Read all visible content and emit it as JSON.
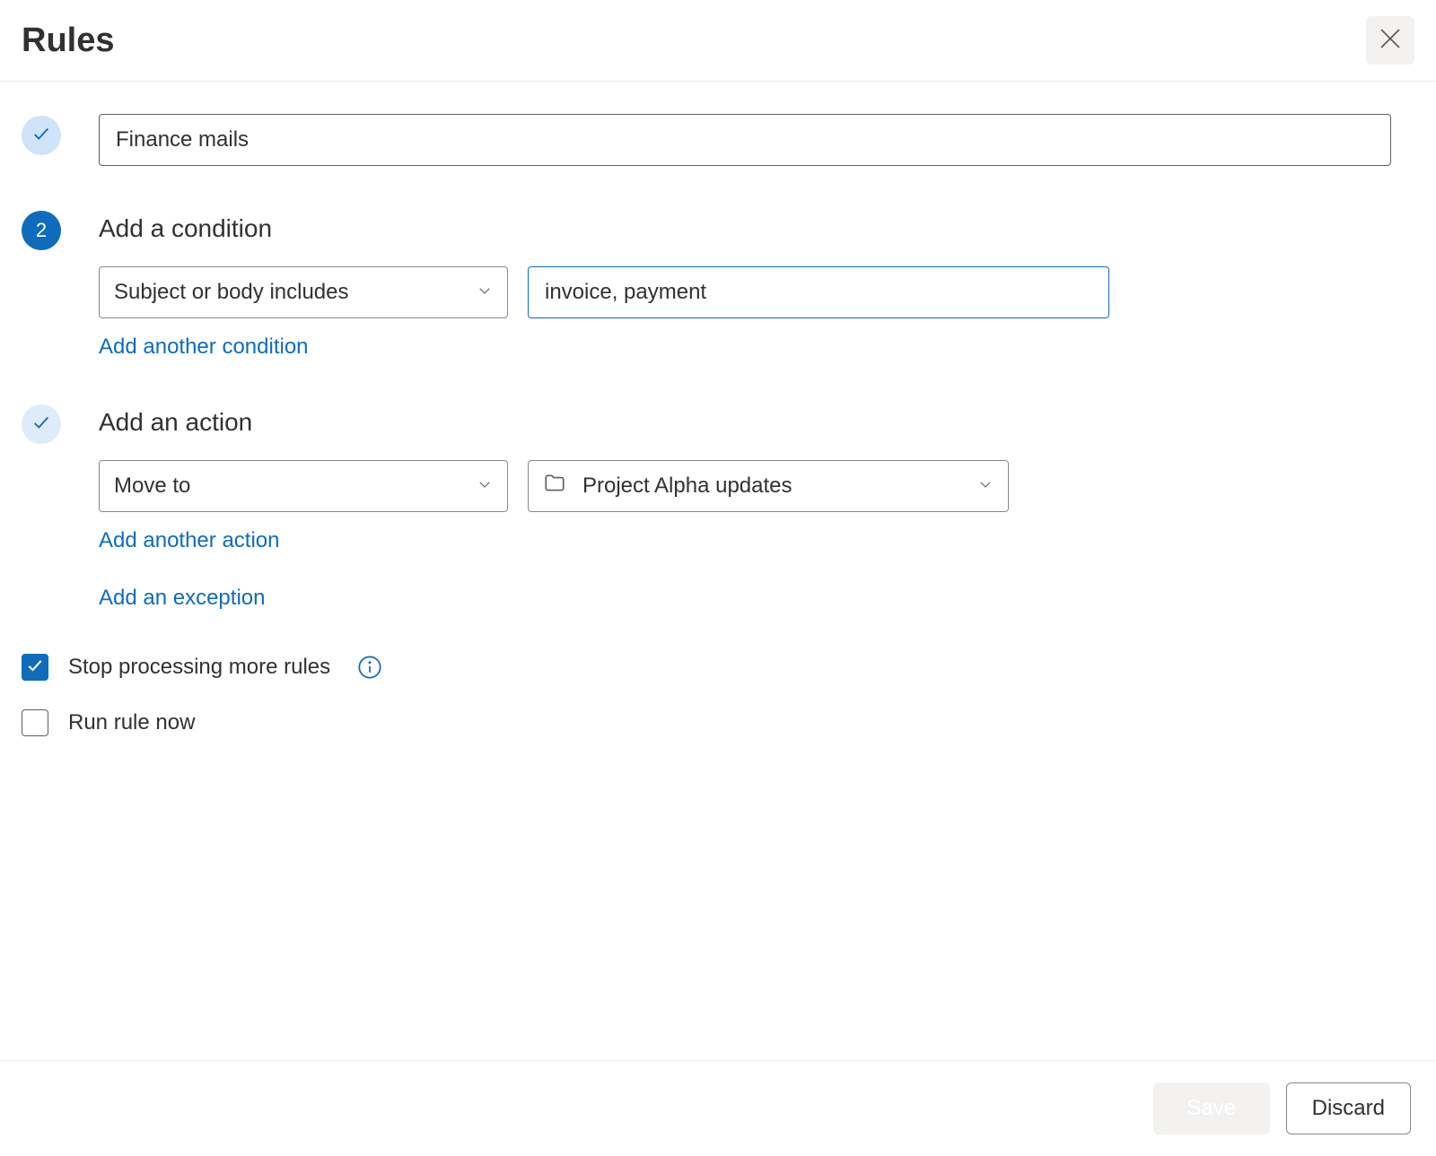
{
  "header": {
    "title": "Rules"
  },
  "step1": {
    "rule_name": "Finance mails"
  },
  "step2": {
    "badge": "2",
    "title": "Add a condition",
    "condition_type": "Subject or body includes",
    "condition_value": "invoice, payment",
    "add_another": "Add another condition"
  },
  "step3": {
    "title": "Add an action",
    "action_type": "Move to",
    "folder": "Project Alpha updates",
    "add_another_action": "Add another action",
    "add_exception": "Add an exception"
  },
  "checks": {
    "stop_processing_label": "Stop processing more rules",
    "stop_processing_checked": true,
    "run_now_label": "Run rule now",
    "run_now_checked": false
  },
  "footer": {
    "save": "Save",
    "discard": "Discard"
  }
}
